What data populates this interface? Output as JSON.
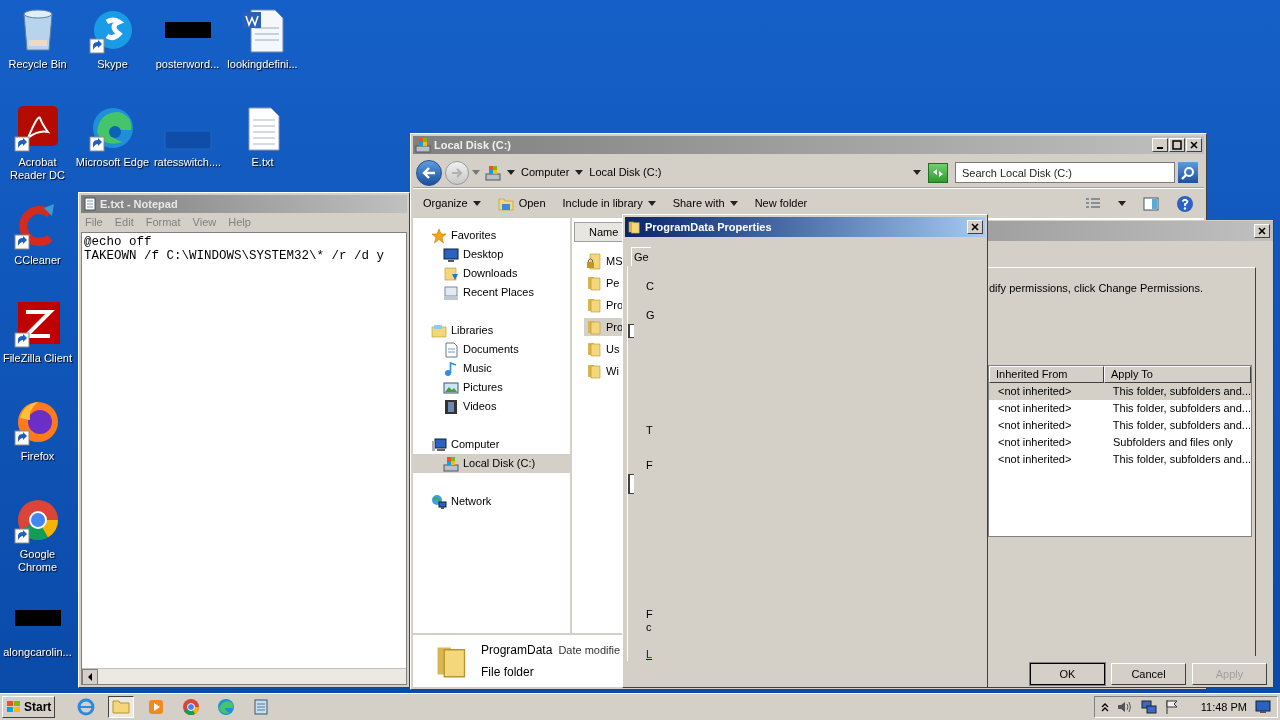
{
  "desktop": {
    "columns": [
      [
        {
          "label": "Recycle Bin",
          "kind": "recycle",
          "shortcut": false
        },
        {
          "label": "Acrobat Reader DC",
          "kind": "acrobat",
          "shortcut": true
        },
        {
          "label": "CCleaner",
          "kind": "ccleaner",
          "shortcut": true
        },
        {
          "label": "FileZilla Client",
          "kind": "filezilla",
          "shortcut": true
        },
        {
          "label": "Firefox",
          "kind": "firefox",
          "shortcut": true
        },
        {
          "label": "Google Chrome",
          "kind": "chrome",
          "shortcut": true
        },
        {
          "label": "alongcarolin...",
          "kind": "redacted",
          "shortcut": false
        }
      ],
      [
        {
          "label": "Skype",
          "kind": "skype",
          "shortcut": true
        },
        {
          "label": "Microsoft Edge",
          "kind": "edge",
          "shortcut": true
        }
      ],
      [
        {
          "label": "posterword...",
          "kind": "redacted",
          "shortcut": false
        },
        {
          "label": "ratesswitch....",
          "kind": "blank",
          "shortcut": false
        }
      ],
      [
        {
          "label": "lookingdefini...",
          "kind": "word",
          "shortcut": false
        },
        {
          "label": "E.txt",
          "kind": "text",
          "shortcut": false
        }
      ]
    ]
  },
  "notepad": {
    "title": "E.txt - Notepad",
    "menu": [
      "File",
      "Edit",
      "Format",
      "View",
      "Help"
    ],
    "lines": [
      "@echo off",
      "TAKEOWN /f C:\\WINDOWS\\SYSTEM32\\* /r /d y"
    ]
  },
  "explorer": {
    "title": "Local Disk (C:)",
    "breadcrumb": [
      "Computer",
      "Local Disk (C:)"
    ],
    "search": {
      "placeholder": "Search Local Disk (C:)"
    },
    "toolbar": [
      {
        "label": "Organize",
        "kind": "menu"
      },
      {
        "label": "Open",
        "kind": "open"
      },
      {
        "label": "Include in library",
        "kind": "menu"
      },
      {
        "label": "Share with",
        "kind": "menu"
      },
      {
        "label": "New folder",
        "kind": "plain"
      }
    ],
    "nav": [
      {
        "label": "Favorites",
        "kind": "star",
        "children": [
          {
            "label": "Desktop",
            "kind": "desktop",
            "selected": false
          },
          {
            "label": "Downloads",
            "kind": "downloads",
            "selected": false
          },
          {
            "label": "Recent Places",
            "kind": "recent",
            "selected": false
          }
        ]
      },
      {
        "label": "Libraries",
        "kind": "library",
        "children": [
          {
            "label": "Documents",
            "kind": "documents",
            "selected": false
          },
          {
            "label": "Music",
            "kind": "music",
            "selected": false
          },
          {
            "label": "Pictures",
            "kind": "pictures",
            "selected": false
          },
          {
            "label": "Videos",
            "kind": "videos",
            "selected": false
          }
        ]
      },
      {
        "label": "Computer",
        "kind": "computer",
        "children": [
          {
            "label": "Local Disk (C:)",
            "kind": "drive",
            "selected": true
          }
        ]
      },
      {
        "label": "Network",
        "kind": "network"
      }
    ],
    "column": "Name",
    "files": [
      {
        "name": "MS",
        "kind": "locked",
        "selected": false
      },
      {
        "name": "Pe",
        "kind": "folder",
        "selected": false
      },
      {
        "name": "Pro",
        "kind": "folder",
        "selected": false
      },
      {
        "name": "Pro",
        "kind": "folder",
        "selected": true
      },
      {
        "name": "Us",
        "kind": "folder",
        "selected": false
      },
      {
        "name": "Wi",
        "kind": "folder",
        "selected": false
      }
    ],
    "details": {
      "name": "ProgramData",
      "field": "Date modifie",
      "type": "File folder"
    }
  },
  "security": {
    "note": "dify permissions, click Change Permissions.",
    "columns": [
      "Inherited From",
      "Apply To"
    ],
    "rows": [
      {
        "cells": [
          "<not inherited>",
          "This folder, subfolders and..."
        ],
        "selected": true
      },
      {
        "cells": [
          "<not inherited>",
          "This folder, subfolders and..."
        ],
        "selected": false
      },
      {
        "cells": [
          "<not inherited>",
          "This folder, subfolders and..."
        ],
        "selected": false
      },
      {
        "cells": [
          "<not inherited>",
          "Subfolders and files only"
        ],
        "selected": false
      },
      {
        "cells": [
          "<not inherited>",
          "This folder, subfolders and..."
        ],
        "selected": false
      }
    ],
    "buttons": [
      {
        "label": "OK",
        "default": true,
        "disabled": false
      },
      {
        "label": "Cancel",
        "default": false,
        "disabled": false
      },
      {
        "label": "Apply",
        "default": false,
        "disabled": true
      }
    ]
  },
  "properties": {
    "title": "ProgramData Properties",
    "tab": "Ge",
    "fragments": [
      {
        "text": "C",
        "kind": "label"
      },
      {
        "text": "G",
        "kind": "boxed"
      },
      {
        "text": "T",
        "kind": "label"
      },
      {
        "text": "F",
        "kind": "boxed"
      },
      {
        "text": "F",
        "kind": "label"
      },
      {
        "text": "c",
        "kind": "label"
      },
      {
        "text": "L",
        "kind": "link"
      }
    ]
  },
  "taskbar": {
    "start": "Start",
    "apps": [
      {
        "kind": "ie",
        "selected": false
      },
      {
        "kind": "folder",
        "selected": true
      },
      {
        "kind": "media",
        "selected": false
      },
      {
        "kind": "chrome",
        "selected": false
      },
      {
        "kind": "edge",
        "selected": false
      },
      {
        "kind": "notepad",
        "selected": false
      }
    ],
    "clock": "11:48 PM"
  }
}
